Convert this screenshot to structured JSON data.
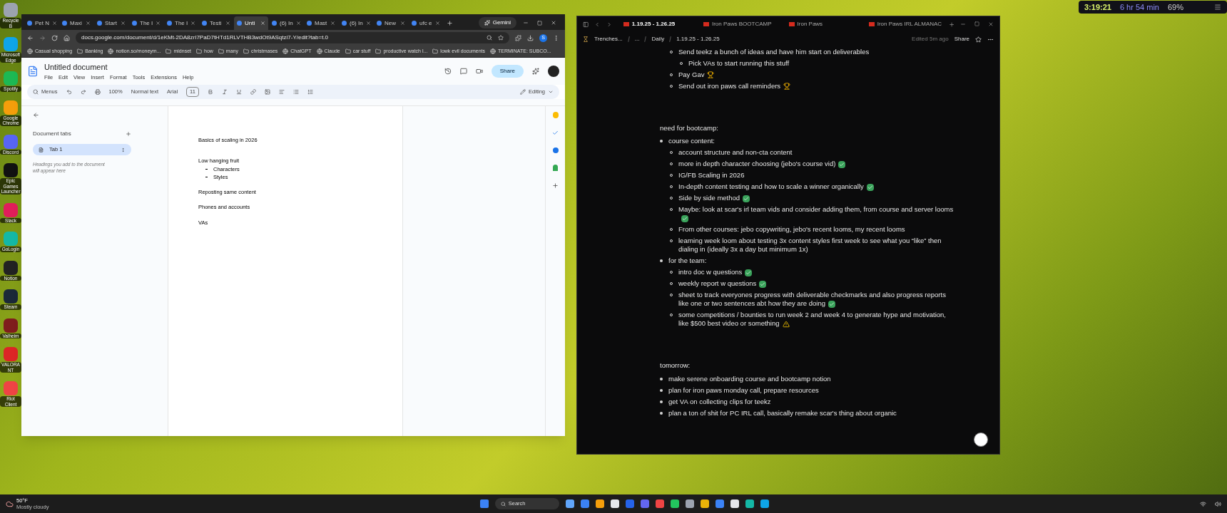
{
  "desktop_icons": [
    {
      "label": "Recycle B",
      "color": "#9ca3af"
    },
    {
      "label": "Microsoft Edge",
      "color": "#0ea5e9"
    },
    {
      "label": "Spotify",
      "color": "#1db954"
    },
    {
      "label": "Google Chrome",
      "color": "#f59e0b"
    },
    {
      "label": "Discord",
      "color": "#5865f2"
    },
    {
      "label": "Epic Games Launcher",
      "color": "#111111"
    },
    {
      "label": "Slack",
      "color": "#e01e5a"
    },
    {
      "label": "GoLogin",
      "color": "#14b8a6"
    },
    {
      "label": "Notion",
      "color": "#222222"
    },
    {
      "label": "Steam",
      "color": "#1b2838"
    },
    {
      "label": "Valheim",
      "color": "#7f1d1d"
    },
    {
      "label": "VALORANT",
      "color": "#dc2626"
    },
    {
      "label": "Riot Client",
      "color": "#ef4444"
    }
  ],
  "widget": {
    "time": "3:19:21",
    "hours": "6 hr 54 min",
    "percent": "69%"
  },
  "browser": {
    "tabs": [
      {
        "label": "Pet N",
        "selected": false
      },
      {
        "label": "Maxi",
        "selected": false
      },
      {
        "label": "Start",
        "selected": false
      },
      {
        "label": "The I",
        "selected": false
      },
      {
        "label": "The I",
        "selected": false
      },
      {
        "label": "Testi",
        "selected": false
      },
      {
        "label": "Unti",
        "selected": true
      },
      {
        "label": "(6) In",
        "selected": false
      },
      {
        "label": "Mast",
        "selected": false
      },
      {
        "label": "(6) In",
        "selected": false
      },
      {
        "label": "New",
        "selected": false
      },
      {
        "label": "ufc e",
        "selected": false
      }
    ],
    "gemini": "Gemini",
    "url": "docs.google.com/document/d/1eKMt-2DA8zrI7PaD7tHTd1RLVTHB3wdOt9ASqtzi7-Y/edit?tab=t.0",
    "profile": "S",
    "bookmarks": [
      {
        "label": "Casual shopping",
        "kind": "page"
      },
      {
        "label": "Banking",
        "kind": "folder"
      },
      {
        "label": "notion.so/moneym...",
        "kind": "page"
      },
      {
        "label": "midnset",
        "kind": "folder"
      },
      {
        "label": "how",
        "kind": "folder"
      },
      {
        "label": "many",
        "kind": "folder"
      },
      {
        "label": "christmases",
        "kind": "folder"
      },
      {
        "label": "ChatGPT",
        "kind": "page"
      },
      {
        "label": "Claude",
        "kind": "page"
      },
      {
        "label": "car stuff",
        "kind": "folder"
      },
      {
        "label": "productive watch l...",
        "kind": "folder"
      },
      {
        "label": "lowk evil documents",
        "kind": "folder"
      },
      {
        "label": "TERMINATE: SUBCO...",
        "kind": "page"
      }
    ]
  },
  "docs": {
    "title": "Untitled document",
    "menus": [
      "File",
      "Edit",
      "View",
      "Insert",
      "Format",
      "Tools",
      "Extensions",
      "Help"
    ],
    "share": "Share",
    "toolbar": {
      "menus": "Menus",
      "zoom": "100%",
      "style": "Normal text",
      "font": "Arial",
      "size": "11",
      "mode": "Editing"
    },
    "sidebar": {
      "heading": "Document tabs",
      "tabs": [
        {
          "label": "Tab 1",
          "selected": true
        }
      ],
      "hint": "Headings you add to the document will appear here"
    },
    "paragraphs": [
      {
        "text": "Basics of scaling in 2026"
      },
      {
        "text": "Low hanging fruit",
        "children": [
          {
            "text": "Characters"
          },
          {
            "text": "Styles"
          }
        ]
      },
      {
        "text": "Reposting same content"
      },
      {
        "text": "Phones and accounts"
      },
      {
        "text": "VAs"
      }
    ]
  },
  "notion": {
    "tabs": [
      {
        "label": "1.19.25 - 1.26.25",
        "selected": true
      },
      {
        "label": "Iron Paws BOOTCAMP",
        "selected": false
      },
      {
        "label": "Iron Paws",
        "selected": false
      },
      {
        "label": "Iron Paws IRL ALMANAC",
        "selected": false
      }
    ],
    "breadcrumb": [
      "Trenches...",
      "...",
      "Daily",
      "1.19.25 - 1.26.25"
    ],
    "edited": "Edited 5m ago",
    "share": "Share",
    "sections": [
      {
        "continued": true,
        "items": [
          {
            "text": "Send teekz a bunch of ideas and have him start on deliverables",
            "kind": "plain",
            "children": [
              {
                "text": "Pick VAs to start running this stuff",
                "kind": "plain"
              }
            ]
          },
          {
            "text": "Pay Gav",
            "kind": "award"
          },
          {
            "text": "Send out iron paws call reminders",
            "kind": "award"
          }
        ]
      },
      {
        "heading": "need for bootcamp:",
        "continued": false,
        "items": [
          {
            "text": "course content:",
            "kind": "plain",
            "children": [
              {
                "text": "account structure and non-cta content",
                "kind": "plain"
              },
              {
                "text": "more in depth character choosing (jebo's course vid)",
                "kind": "done"
              },
              {
                "text": "IG/FB Scaling in 2026",
                "kind": "plain"
              },
              {
                "text": "In-depth content testing and how to scale a winner organically",
                "kind": "done"
              },
              {
                "text": "Side by side method",
                "kind": "done"
              },
              {
                "text": "Maybe: look at scar's irl team vids and consider adding them, from course and server looms",
                "kind": "done"
              },
              {
                "text": "From other courses: jebo copywriting, jebo's recent looms, my recent looms",
                "kind": "plain"
              },
              {
                "text": "learning week loom about testing 3x content styles first week to see what you “like” then dialing in (ideally 3x a day but minimum 1x)",
                "kind": "plain"
              }
            ]
          },
          {
            "text": "for the team:",
            "kind": "plain",
            "children": [
              {
                "text": "intro doc w questions",
                "kind": "done"
              },
              {
                "text": "weekly report w questions",
                "kind": "done"
              },
              {
                "text": "sheet to track everyones progress with deliverable checkmarks and also progress reports like one or two sentences abt how they are doing",
                "kind": "done"
              },
              {
                "text": "some competitions / bounties to run week 2 and week 4 to generate hype and motivation, like $500 best video or something",
                "kind": "warning"
              }
            ]
          }
        ]
      },
      {
        "heading": "tomorrow:",
        "continued": false,
        "items": [
          {
            "text": "make serene onboarding course and bootcamp notion",
            "kind": "plain"
          },
          {
            "text": "plan for iron paws monday call, prepare resources",
            "kind": "plain"
          },
          {
            "text": "get VA on collecting clips for teekz",
            "kind": "plain"
          },
          {
            "text": "plan a ton of shit for PC IRL call, basically remake scar's thing about organic",
            "kind": "plain"
          }
        ]
      }
    ]
  },
  "taskbar": {
    "weather_temp": "50°F",
    "weather_text": "Mostly cloudy",
    "search": "Search"
  }
}
